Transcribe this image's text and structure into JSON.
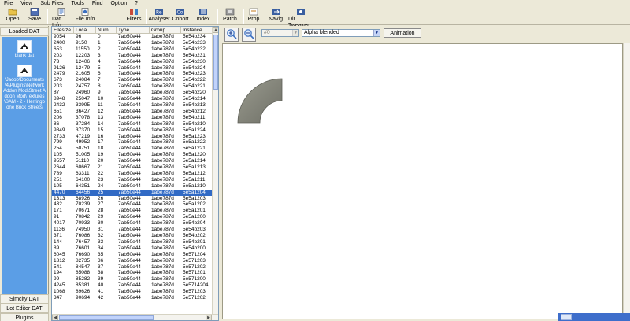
{
  "menu": [
    "File",
    "View",
    "Sub Files",
    "Tools",
    "Find",
    "Option",
    "?"
  ],
  "toolbar": [
    {
      "label": "Open",
      "icon": "folder-icon"
    },
    {
      "label": "Save",
      "icon": "save-icon"
    },
    {
      "label": "Dat Info",
      "icon": "info-icon"
    },
    {
      "label": "File Info",
      "icon": "file-info-icon"
    },
    {
      "label": "Filters",
      "icon": "filter-icon"
    },
    {
      "label": "Analyser",
      "icon": "analyser-icon"
    },
    {
      "label": "Cohort",
      "icon": "cohort-icon"
    },
    {
      "label": "Index",
      "icon": "index-icon"
    },
    {
      "label": "Patch",
      "icon": "patch-icon"
    },
    {
      "label": "Prop",
      "icon": "prop-icon"
    },
    {
      "label": "Navig.",
      "icon": "navigate-icon"
    },
    {
      "label": "Dir Tweaker",
      "icon": "dir-tweaker-icon"
    }
  ],
  "left_panel": {
    "header": "Loaded DAT",
    "items": [
      {
        "name": "blank dat"
      },
      {
        "name": "\\Jacob\\Documents\\4\\Plugins\\Network Addon Mod\\Street Addon Mod\\Textures\\SAM - 2 - Herringbone Brick Streets"
      }
    ],
    "buttons": [
      "Simcity DAT",
      "Lot Editor DAT",
      "Plugins"
    ]
  },
  "grid": {
    "columns": [
      "Filesize",
      "Loca...",
      "Num",
      "Type",
      "Group",
      "Instance"
    ],
    "selected_index": 25,
    "rows": [
      [
        "9054",
        "96",
        "0",
        "7ab50e44",
        "1abe787d",
        "5e54b234"
      ],
      [
        "2400",
        "9150",
        "1",
        "7ab50e44",
        "1abe787d",
        "5e54b233"
      ],
      [
        "653",
        "11550",
        "2",
        "7ab50e44",
        "1abe787d",
        "5e54b232"
      ],
      [
        "203",
        "12203",
        "3",
        "7ab50e44",
        "1abe787d",
        "5e54b231"
      ],
      [
        "73",
        "12406",
        "4",
        "7ab50e44",
        "1abe787d",
        "5e54b230"
      ],
      [
        "9126",
        "12479",
        "5",
        "7ab50e44",
        "1abe787d",
        "5e54b224"
      ],
      [
        "2479",
        "21605",
        "6",
        "7ab50e44",
        "1abe787d",
        "5e54b223"
      ],
      [
        "673",
        "24084",
        "7",
        "7ab50e44",
        "1abe787d",
        "5e54b222"
      ],
      [
        "203",
        "24757",
        "8",
        "7ab50e44",
        "1abe787d",
        "5e54b221"
      ],
      [
        "87",
        "24960",
        "9",
        "7ab50e44",
        "1abe787d",
        "5e54b220"
      ],
      [
        "8948",
        "25047",
        "10",
        "7ab50e44",
        "1abe787d",
        "5e54b214"
      ],
      [
        "2432",
        "33995",
        "11",
        "7ab50e44",
        "1abe787d",
        "5e54b213"
      ],
      [
        "651",
        "36427",
        "12",
        "7ab50e44",
        "1abe787d",
        "5e54b212"
      ],
      [
        "206",
        "37078",
        "13",
        "7ab50e44",
        "1abe787d",
        "5e54b211"
      ],
      [
        "86",
        "37284",
        "14",
        "7ab50e44",
        "1abe787d",
        "5e54b210"
      ],
      [
        "9849",
        "37370",
        "15",
        "7ab50e44",
        "1abe787d",
        "5e5a1224"
      ],
      [
        "2733",
        "47219",
        "16",
        "7ab50e44",
        "1abe787d",
        "5e5a1223"
      ],
      [
        "799",
        "49952",
        "17",
        "7ab50e44",
        "1abe787d",
        "5e5a1222"
      ],
      [
        "254",
        "50751",
        "18",
        "7ab50e44",
        "1abe787d",
        "5e5a1221"
      ],
      [
        "105",
        "51005",
        "19",
        "7ab50e44",
        "1abe787d",
        "5e5a1220"
      ],
      [
        "9557",
        "51110",
        "20",
        "7ab50e44",
        "1abe787d",
        "5e5a1214"
      ],
      [
        "2644",
        "60667",
        "21",
        "7ab50e44",
        "1abe787d",
        "5e5a1213"
      ],
      [
        "789",
        "63311",
        "22",
        "7ab50e44",
        "1abe787d",
        "5e5a1212"
      ],
      [
        "251",
        "64100",
        "23",
        "7ab50e44",
        "1abe787d",
        "5e5a1211"
      ],
      [
        "105",
        "64351",
        "24",
        "7ab50e44",
        "1abe787d",
        "5e5a1210"
      ],
      [
        "4470",
        "64456",
        "25",
        "7ab50e44",
        "1abe787d",
        "5e5a1204"
      ],
      [
        "1313",
        "68926",
        "26",
        "7ab50e44",
        "1abe787d",
        "5e5a1203"
      ],
      [
        "432",
        "70239",
        "27",
        "7ab50e44",
        "1abe787d",
        "5e5a1202"
      ],
      [
        "171",
        "70671",
        "28",
        "7ab50e44",
        "1abe787d",
        "5e5a1201"
      ],
      [
        "91",
        "70842",
        "29",
        "7ab50e44",
        "1abe787d",
        "5e5a1200"
      ],
      [
        "4017",
        "70933",
        "30",
        "7ab50e44",
        "1abe787d",
        "5e54b204"
      ],
      [
        "1136",
        "74950",
        "31",
        "7ab50e44",
        "1abe787d",
        "5e54b203"
      ],
      [
        "371",
        "76086",
        "32",
        "7ab50e44",
        "1abe787d",
        "5e54b202"
      ],
      [
        "144",
        "76457",
        "33",
        "7ab50e44",
        "1abe787d",
        "5e54b201"
      ],
      [
        "89",
        "76601",
        "34",
        "7ab50e44",
        "1abe787d",
        "5e54b200"
      ],
      [
        "6045",
        "76690",
        "35",
        "7ab50e44",
        "1abe787d",
        "5e571204"
      ],
      [
        "1812",
        "82735",
        "36",
        "7ab50e44",
        "1abe787d",
        "5e571203"
      ],
      [
        "541",
        "84547",
        "37",
        "7ab50e44",
        "1abe787d",
        "5e571202"
      ],
      [
        "194",
        "85088",
        "38",
        "7ab50e44",
        "1abe787d",
        "5e571201"
      ],
      [
        "99",
        "85282",
        "39",
        "7ab50e44",
        "1abe787d",
        "5e571200"
      ],
      [
        "4245",
        "85381",
        "40",
        "7ab50e44",
        "1abe787d",
        "5e5714204"
      ],
      [
        "1068",
        "89626",
        "41",
        "7ab50e44",
        "1abe787d",
        "5e571203"
      ],
      [
        "347",
        "90694",
        "42",
        "7ab50e44",
        "1abe787d",
        "5e571202"
      ]
    ]
  },
  "viewer": {
    "index_field": "#0",
    "blend_mode": "Alpha blended",
    "animation_label": "Animation"
  },
  "colors": {
    "selection": "#316ac5",
    "loaded_dat_panel": "#5b9ee6",
    "window_face": "#ece9d8"
  }
}
